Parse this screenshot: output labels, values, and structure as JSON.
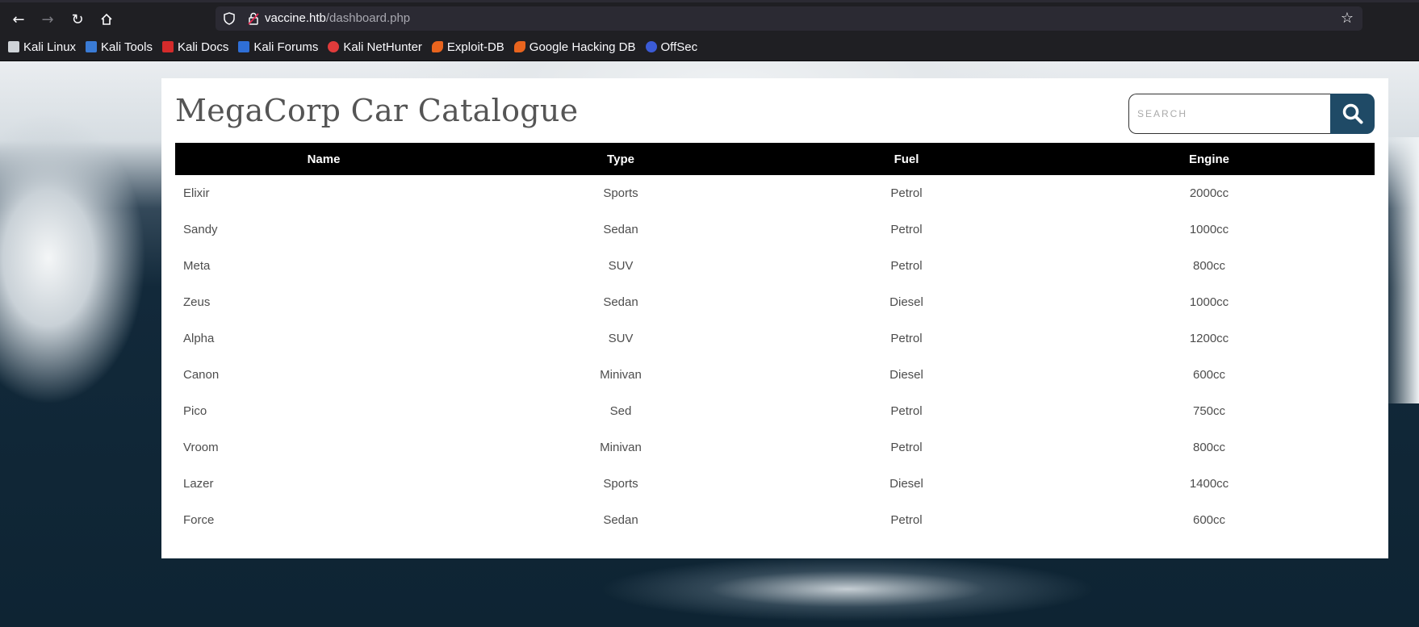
{
  "browser": {
    "url_host": "vaccine.htb",
    "url_path": "/dashboard.php",
    "bookmarks": [
      {
        "label": "Kali Linux",
        "icon": "kali-dragon-icon",
        "color": "#cfd3d8"
      },
      {
        "label": "Kali Tools",
        "icon": "kali-tools-icon",
        "color": "#3a7bd5"
      },
      {
        "label": "Kali Docs",
        "icon": "kali-docs-icon",
        "color": "#d42b2b"
      },
      {
        "label": "Kali Forums",
        "icon": "kali-forums-icon",
        "color": "#2f6fd6"
      },
      {
        "label": "Kali NetHunter",
        "icon": "kali-nethunter-icon",
        "color": "#e03b3b"
      },
      {
        "label": "Exploit-DB",
        "icon": "exploit-db-icon",
        "color": "#e8641e"
      },
      {
        "label": "Google Hacking DB",
        "icon": "ghdb-icon",
        "color": "#e8641e"
      },
      {
        "label": "OffSec",
        "icon": "offsec-icon",
        "color": "#3b5bd6"
      }
    ]
  },
  "page": {
    "title": "MegaCorp Car Catalogue",
    "search": {
      "placeholder": "SEARCH",
      "value": ""
    },
    "accent": "#1f4a66"
  },
  "table": {
    "headers": [
      "Name",
      "Type",
      "Fuel",
      "Engine"
    ],
    "rows": [
      [
        "Elixir",
        "Sports",
        "Petrol",
        "2000cc"
      ],
      [
        "Sandy",
        "Sedan",
        "Petrol",
        "1000cc"
      ],
      [
        "Meta",
        "SUV",
        "Petrol",
        "800cc"
      ],
      [
        "Zeus",
        "Sedan",
        "Diesel",
        "1000cc"
      ],
      [
        "Alpha",
        "SUV",
        "Petrol",
        "1200cc"
      ],
      [
        "Canon",
        "Minivan",
        "Diesel",
        "600cc"
      ],
      [
        "Pico",
        "Sed",
        "Petrol",
        "750cc"
      ],
      [
        "Vroom",
        "Minivan",
        "Petrol",
        "800cc"
      ],
      [
        "Lazer",
        "Sports",
        "Diesel",
        "1400cc"
      ],
      [
        "Force",
        "Sedan",
        "Petrol",
        "600cc"
      ]
    ]
  }
}
